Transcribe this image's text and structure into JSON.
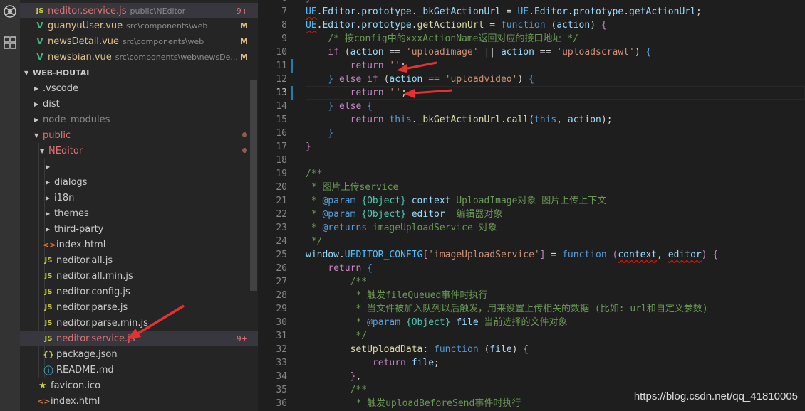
{
  "explorer": {
    "open_editors": [
      {
        "icon": "JS",
        "name": "neditor.service.js",
        "path": "public\\NEditor",
        "badge": "9+",
        "selected": true
      },
      {
        "icon": "V",
        "name": "guanyuUser.vue",
        "path": "src\\components\\web",
        "badge": "M"
      },
      {
        "icon": "V",
        "name": "newsDetail.vue",
        "path": "src\\components\\web",
        "badge": "M"
      },
      {
        "icon": "V",
        "name": "newsbian.vue",
        "path": "src\\components\\web\\newsDe...",
        "badge": "M"
      }
    ],
    "section_title": "WEB-HOUTAI",
    "tree": [
      {
        "name": ".vscode"
      },
      {
        "name": "dist"
      },
      {
        "name": "node_modules"
      },
      {
        "name": "public"
      },
      {
        "name": "NEditor"
      },
      {
        "name": "_"
      },
      {
        "name": "dialogs"
      },
      {
        "name": "i18n"
      },
      {
        "name": "themes"
      },
      {
        "name": "third-party"
      },
      {
        "name": "index.html",
        "icon": "<>"
      },
      {
        "name": "neditor.all.js",
        "icon": "JS"
      },
      {
        "name": "neditor.all.min.js",
        "icon": "JS"
      },
      {
        "name": "neditor.config.js",
        "icon": "JS"
      },
      {
        "name": "neditor.parse.js",
        "icon": "JS"
      },
      {
        "name": "neditor.parse.min.js",
        "icon": "JS"
      },
      {
        "name": "neditor.service.js",
        "icon": "JS",
        "badge": "9+"
      },
      {
        "name": "package.json",
        "icon": "{}"
      },
      {
        "name": "README.md",
        "icon": "ⓘ"
      },
      {
        "name": "favicon.ico",
        "icon": "★"
      },
      {
        "name": "index.html",
        "icon": "<>"
      }
    ]
  },
  "editor": {
    "line_numbers": [
      "6",
      "7",
      "8",
      "9",
      "10",
      "11",
      "12",
      "13",
      "14",
      "15",
      "16",
      "17",
      "18",
      "19",
      "20",
      "21",
      "22",
      "23",
      "24",
      "25",
      "26",
      "27",
      "28",
      "29",
      "30",
      "31",
      "32",
      "33",
      "34",
      "35",
      "36"
    ],
    "current_line": "13"
  },
  "watermark": "https://blog.csdn.net/qq_41810005",
  "colors": {
    "accent_arrow": "#e8302f",
    "modified": "#e2c08d",
    "error": "#e27373"
  }
}
